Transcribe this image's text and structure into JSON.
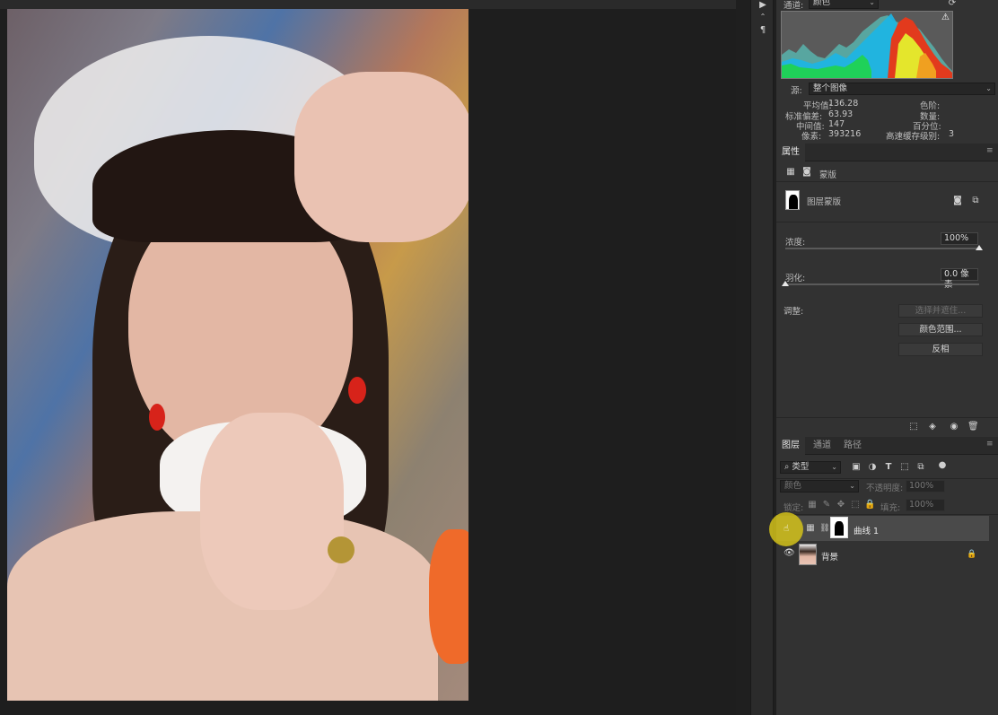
{
  "histogram": {
    "channel_label": "通道:",
    "channel_value": "颜色",
    "warning_icon": "warning-icon",
    "source_label": "源:",
    "source_value": "整个图像",
    "stats": {
      "mean_label": "平均值:",
      "mean": "136.28",
      "stddev_label": "标准偏差:",
      "stddev": "63.93",
      "median_label": "中间值:",
      "median": "147",
      "pixels_label": "像素:",
      "pixels": "393216",
      "level_label": "色阶:",
      "level": "",
      "count_label": "数量:",
      "count": "",
      "percentile_label": "百分位:",
      "percentile": "",
      "cache_label": "高速缓存级别:",
      "cache": "3"
    }
  },
  "properties": {
    "tab": "属性",
    "mask_label": "蒙版",
    "layer_mask_label": "图层蒙版",
    "density_label": "浓度:",
    "density_value": "100%",
    "density_level": 1.0,
    "feather_label": "羽化:",
    "feather_value": "0.0 像素",
    "feather_level": 0.0,
    "adjust_label": "调整:",
    "select_and_mask": "选择并遮住...",
    "color_range": "颜色范围...",
    "invert": "反相"
  },
  "layers": {
    "tabs": [
      "图层",
      "通道",
      "路径"
    ],
    "filter_kind": "类型",
    "blend_mode": "颜色",
    "opacity_label": "不透明度:",
    "opacity_value": "100%",
    "lock_label": "锁定:",
    "fill_label": "填充:",
    "fill_value": "100%",
    "items": [
      {
        "name": "曲线 1",
        "selected": true
      },
      {
        "name": "背景",
        "selected": false
      }
    ]
  },
  "colors": {
    "panel_bg": "#323232",
    "highlight_cursor": "#d4c21a"
  }
}
